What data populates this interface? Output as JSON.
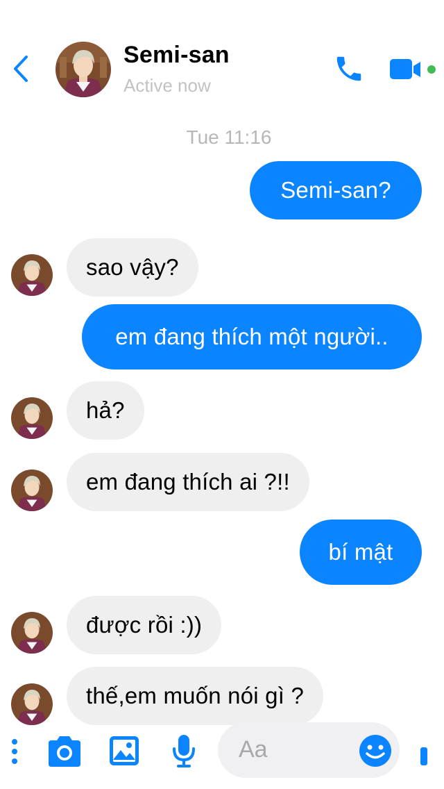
{
  "header": {
    "title": "Semi-san",
    "status": "Active now",
    "back_icon": "chevron-left-icon",
    "call_icon": "phone-icon",
    "video_icon": "video-camera-icon",
    "online_indicator_color": "#44bb55"
  },
  "timestamp": "Tue 11:16",
  "messages": [
    {
      "direction": "out",
      "text": "Semi-san?"
    },
    {
      "direction": "in",
      "text": "sao vậy?"
    },
    {
      "direction": "out",
      "text": "em đang thích một người.."
    },
    {
      "direction": "in",
      "text": "hả?"
    },
    {
      "direction": "in",
      "text": "em đang thích ai ?!!"
    },
    {
      "direction": "out",
      "text": "bí mật"
    },
    {
      "direction": "in",
      "text": "được rồi :))"
    },
    {
      "direction": "in",
      "text": "thế,em muốn nói gì ?"
    }
  ],
  "composer": {
    "placeholder": "Aa",
    "icons": [
      "more-icon",
      "camera-icon",
      "image-icon",
      "microphone-icon",
      "emoji-icon",
      "like-icon"
    ]
  },
  "colors": {
    "accent": "#0a84ff",
    "incoming_bubble": "#efeff0",
    "muted_text": "#c2c2c6"
  }
}
